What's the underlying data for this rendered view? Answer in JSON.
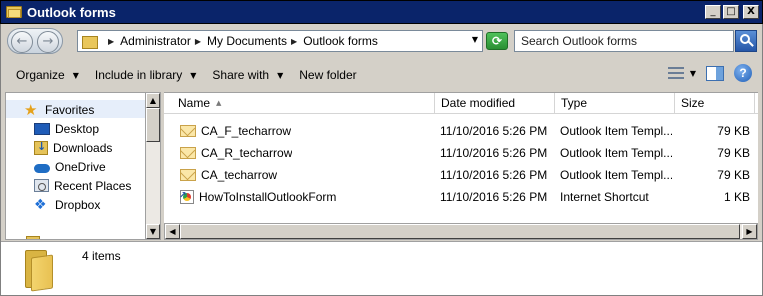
{
  "window": {
    "title": "Outlook forms",
    "controls": {
      "minimize": "_",
      "maximize": "□",
      "close": "X"
    }
  },
  "navigation": {
    "back_icon": "back-arrow-icon",
    "forward_icon": "forward-arrow-icon",
    "breadcrumb": [
      "Administrator",
      "My Documents",
      "Outlook forms"
    ],
    "refresh_icon": "refresh-icon"
  },
  "search": {
    "placeholder": "Search Outlook forms",
    "icon": "search-icon"
  },
  "toolbar": {
    "organize": "Organize",
    "include_in_library": "Include in library",
    "share_with": "Share with",
    "new_folder": "New folder",
    "right_icons": [
      "views-icon",
      "preview-pane-icon",
      "help-icon"
    ]
  },
  "sidebar": {
    "favorites_label": "Favorites",
    "items": [
      {
        "label": "Desktop",
        "icon": "desktop-icon"
      },
      {
        "label": "Downloads",
        "icon": "downloads-icon"
      },
      {
        "label": "OneDrive",
        "icon": "onedrive-icon"
      },
      {
        "label": "Recent Places",
        "icon": "recent-places-icon"
      },
      {
        "label": "Dropbox",
        "icon": "dropbox-icon"
      }
    ]
  },
  "file_list": {
    "columns": [
      "Name",
      "Date modified",
      "Type",
      "Size"
    ],
    "rows": [
      {
        "name": "CA_F_techarrow",
        "date": "11/10/2016 5:26 PM",
        "type": "Outlook Item Templ...",
        "size": "79 KB",
        "icon": "envelope-icon"
      },
      {
        "name": "CA_R_techarrow",
        "date": "11/10/2016 5:26 PM",
        "type": "Outlook Item Templ...",
        "size": "79 KB",
        "icon": "envelope-icon"
      },
      {
        "name": "CA_techarrow",
        "date": "11/10/2016 5:26 PM",
        "type": "Outlook Item Templ...",
        "size": "79 KB",
        "icon": "envelope-icon"
      },
      {
        "name": "HowToInstallOutlookForm",
        "date": "11/10/2016 5:26 PM",
        "type": "Internet Shortcut",
        "size": "1 KB",
        "icon": "internet-shortcut-icon"
      }
    ]
  },
  "details": {
    "item_count": "4 items",
    "icon": "folder-icon"
  },
  "colors": {
    "title_bar": "#0a246a",
    "chrome": "#d4d0c8",
    "favorites_highlight": "#e6eefa"
  }
}
